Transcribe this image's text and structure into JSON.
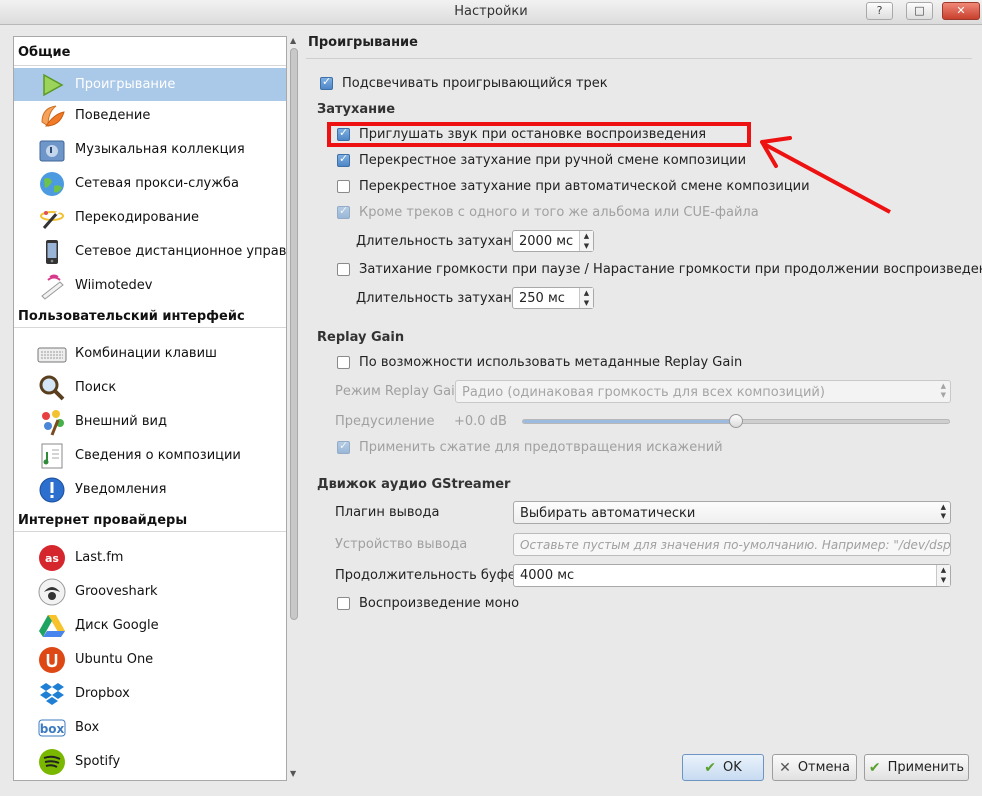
{
  "window": {
    "title": "Настройки",
    "controls": [
      "?",
      "□",
      "✕"
    ]
  },
  "sidebar": {
    "groups": [
      {
        "label": "Общие",
        "items": [
          {
            "label": "Проигрывание",
            "icon": "play-icon",
            "selected": true
          },
          {
            "label": "Поведение",
            "icon": "clementine-icon"
          },
          {
            "label": "Музыкальная коллекция",
            "icon": "music-folder-icon"
          },
          {
            "label": "Сетевая прокси-служба",
            "icon": "globe-icon"
          },
          {
            "label": "Перекодирование",
            "icon": "magic-wand-icon"
          },
          {
            "label": "Сетевое дистанционное управл...",
            "icon": "phone-icon"
          },
          {
            "label": "Wiimotedev",
            "icon": "wiimote-icon"
          }
        ]
      },
      {
        "label": "Пользовательский интерфейс",
        "items": [
          {
            "label": "Комбинации клавиш",
            "icon": "keyboard-icon"
          },
          {
            "label": "Поиск",
            "icon": "magnifier-icon"
          },
          {
            "label": "Внешний вид",
            "icon": "paint-icon"
          },
          {
            "label": "Сведения о композиции",
            "icon": "song-info-icon"
          },
          {
            "label": "Уведомления",
            "icon": "info-icon"
          }
        ]
      },
      {
        "label": "Интернет провайдеры",
        "items": [
          {
            "label": "Last.fm",
            "icon": "lastfm-icon"
          },
          {
            "label": "Grooveshark",
            "icon": "grooveshark-icon"
          },
          {
            "label": "Диск Google",
            "icon": "google-drive-icon"
          },
          {
            "label": "Ubuntu One",
            "icon": "ubuntu-one-icon"
          },
          {
            "label": "Dropbox",
            "icon": "dropbox-icon"
          },
          {
            "label": "Box",
            "icon": "box-icon"
          },
          {
            "label": "Spotify",
            "icon": "spotify-icon"
          }
        ]
      }
    ]
  },
  "panel": {
    "title": "Проигрывание",
    "highlight_track": {
      "label": "Подсвечивать проигрывающийся трек",
      "checked": true
    },
    "fading": {
      "heading": "Затухание",
      "fade_on_stop": {
        "label": "Приглушать звук при остановке воспроизведения",
        "checked": true
      },
      "crossfade_manual": {
        "label": "Перекрестное затухание при ручной смене композиции",
        "checked": true
      },
      "crossfade_auto": {
        "label": "Перекрестное затухание при автоматической смене композиции",
        "checked": false
      },
      "except_same_album": {
        "label": "Кроме треков с одного и того же альбома или CUE-файла",
        "checked": true,
        "disabled": true
      },
      "duration_label": "Длительность затухания",
      "duration_value": "2000 мс",
      "pause_fade": {
        "label": "Затихание громкости при паузе / Нарастание громкости при продолжении воспроизведения",
        "checked": false
      },
      "pause_duration_label": "Длительность затухания",
      "pause_duration_value": "250 мс"
    },
    "replay_gain": {
      "heading": "Replay Gain",
      "use_metadata": {
        "label": "По возможности использовать метаданные Replay Gain",
        "checked": false
      },
      "mode_label": "Режим Replay Gain",
      "mode_value": "Радио (одинаковая громкость для всех композиций)",
      "preamp_label": "Предусиление",
      "preamp_value": "+0.0 dB",
      "preamp_level": 0.49,
      "compression": {
        "label": "Применить сжатие для предотвращения искажений",
        "checked": true,
        "disabled": true
      }
    },
    "gstreamer": {
      "heading": "Движок аудио GStreamer",
      "output_plugin_label": "Плагин вывода",
      "output_plugin_value": "Выбирать автоматически",
      "output_device_label": "Устройство вывода",
      "output_device_placeholder": "Оставьте пустым для значения по-умолчанию. Например: \"/dev/dsp\", \"fro...",
      "buffer_label": "Продолжительность буфера",
      "buffer_value": "4000 мс",
      "mono": {
        "label": "Воспроизведение моно",
        "checked": false
      }
    }
  },
  "buttons": {
    "ok": "OK",
    "cancel": "Отмена",
    "apply": "Применить"
  },
  "annotation": {
    "color": "#ee1111"
  }
}
